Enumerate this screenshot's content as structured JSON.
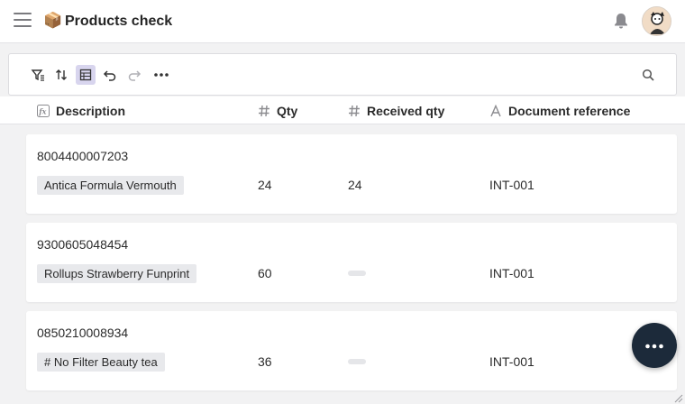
{
  "app": {
    "title": "Products check",
    "emoji": "📦"
  },
  "toolbar": {
    "buttons": [
      "filter-icon",
      "sort-icon",
      "layout-icon",
      "undo-icon",
      "redo-icon",
      "more-icon"
    ],
    "search_icon": "search-icon"
  },
  "columns": [
    {
      "label": "Description",
      "type_icon": "formula-icon"
    },
    {
      "label": "Qty",
      "type_icon": "hash-icon"
    },
    {
      "label": "Received qty",
      "type_icon": "hash-icon"
    },
    {
      "label": "Document reference",
      "type_icon": "text-icon"
    }
  ],
  "rows": [
    {
      "barcode": "8004400007203",
      "name": "Antica Formula Vermouth",
      "qty": "24",
      "received": "24",
      "doc_ref": "INT-001"
    },
    {
      "barcode": "9300605048454",
      "name": "Rollups Strawberry Funprint",
      "qty": "60",
      "received": "",
      "doc_ref": "INT-001"
    },
    {
      "barcode": "0850210008934",
      "name": "# No Filter Beauty tea",
      "qty": "36",
      "received": "",
      "doc_ref": "INT-001"
    }
  ],
  "colors": {
    "accent_active": "#d8d5ee",
    "fab": "#1c2a3a",
    "chip": "#e8e9ec"
  }
}
